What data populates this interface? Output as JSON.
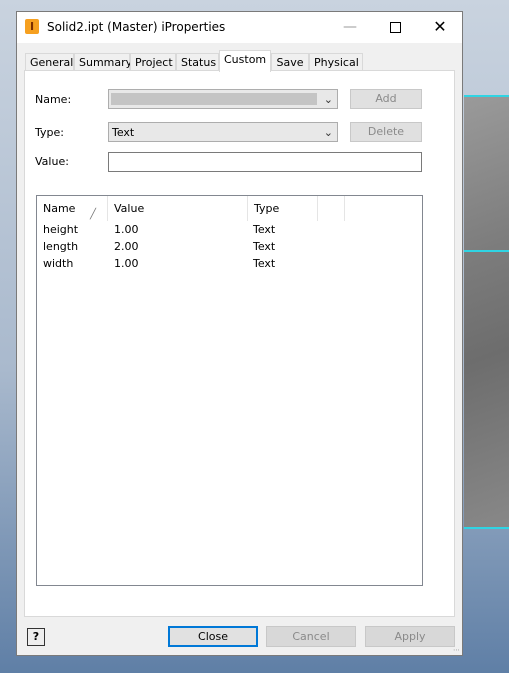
{
  "window": {
    "title": "Solid2.ipt (Master) iProperties",
    "app_icon": "inventor-icon",
    "minimize_glyph": "—",
    "close_glyph": "✕"
  },
  "tabs": [
    {
      "label": "General",
      "active": false
    },
    {
      "label": "Summary",
      "active": false
    },
    {
      "label": "Project",
      "active": false
    },
    {
      "label": "Status",
      "active": false
    },
    {
      "label": "Custom",
      "active": true
    },
    {
      "label": "Save",
      "active": false
    },
    {
      "label": "Physical",
      "active": false
    }
  ],
  "form": {
    "name_label": "Name:",
    "name_value": "",
    "add_label": "Add",
    "type_label": "Type:",
    "type_value": "Text",
    "delete_label": "Delete",
    "value_label": "Value:",
    "value_value": ""
  },
  "table": {
    "columns": [
      "Name",
      "Value",
      "Type"
    ],
    "rows": [
      {
        "name": "height",
        "value": "1.00",
        "type": "Text"
      },
      {
        "name": "length",
        "value": "2.00",
        "type": "Text"
      },
      {
        "name": "width",
        "value": "1.00",
        "type": "Text"
      }
    ]
  },
  "footer": {
    "help_label": "?",
    "close_label": "Close",
    "cancel_label": "Cancel",
    "apply_label": "Apply"
  },
  "colors": {
    "accent": "#0078d7",
    "highlight_edge": "#2fd4e3"
  }
}
